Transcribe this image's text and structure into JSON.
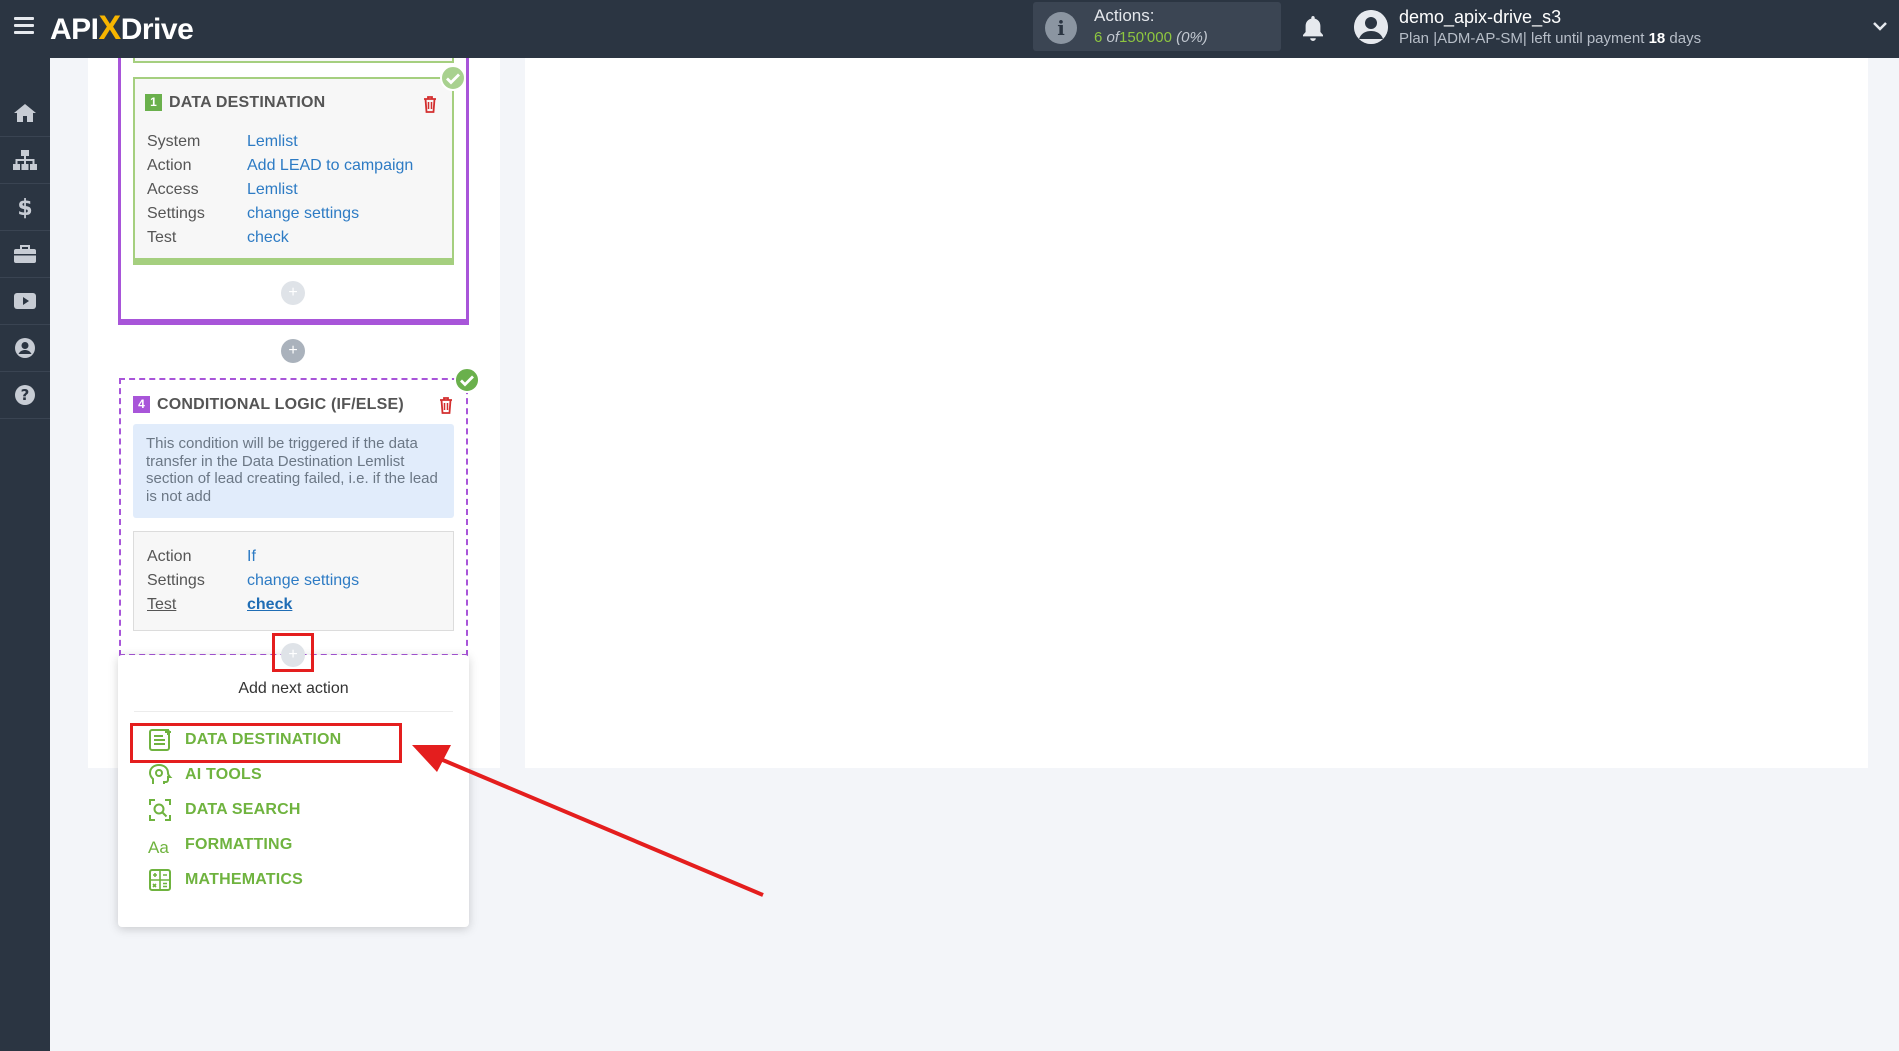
{
  "header": {
    "logo_api": "API",
    "logo_x": "X",
    "logo_drive": "Drive",
    "actions_label": "Actions:",
    "actions_used": "6",
    "actions_of": "of",
    "actions_total": "150'000",
    "actions_percent": "(0%)",
    "username": "demo_apix-drive_s3",
    "plan_prefix": "Plan |ADM-AP-SM| left until payment",
    "plan_days": "18",
    "plan_suffix": "days"
  },
  "sidebar": {
    "items": [
      "home-icon",
      "sitemap-icon",
      "dollar-icon",
      "briefcase-icon",
      "video-icon",
      "user-icon",
      "help-icon"
    ]
  },
  "destination_card": {
    "number": "1",
    "title": "DATA DESTINATION",
    "rows": [
      {
        "key": "System",
        "value": "Lemlist"
      },
      {
        "key": "Action",
        "value": "Add LEAD to campaign"
      },
      {
        "key": "Access",
        "value": "Lemlist"
      },
      {
        "key": "Settings",
        "value": "change settings"
      },
      {
        "key": "Test",
        "value": "check"
      }
    ]
  },
  "conditional_card": {
    "number": "4",
    "title": "CONDITIONAL LOGIC (IF/ELSE)",
    "description": "This condition will be triggered if the data transfer in the Data Destination Lemlist section of lead creating failed, i.e. if the lead is not add",
    "rows": [
      {
        "key": "Action",
        "value": "If"
      },
      {
        "key": "Settings",
        "value": "change settings"
      },
      {
        "key": "Test",
        "value": "check"
      }
    ]
  },
  "dropdown": {
    "title": "Add next action",
    "items": [
      {
        "label": "DATA DESTINATION",
        "icon": "data-destination-icon"
      },
      {
        "label": "AI TOOLS",
        "icon": "ai-tools-icon"
      },
      {
        "label": "DATA SEARCH",
        "icon": "data-search-icon"
      },
      {
        "label": "FORMATTING",
        "icon": "formatting-icon"
      },
      {
        "label": "MATHEMATICS",
        "icon": "mathematics-icon"
      }
    ]
  },
  "colors": {
    "topbar": "#2b3542",
    "accent_green": "#6fb33f",
    "group_purple": "#a855d9",
    "link_blue": "#2d7bc4",
    "highlight_red": "#e41e1e"
  }
}
